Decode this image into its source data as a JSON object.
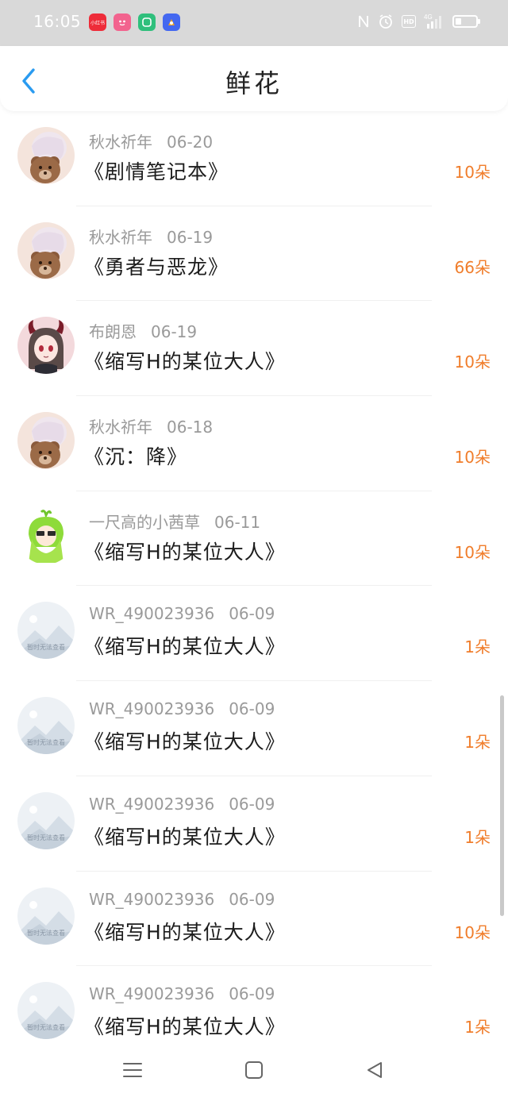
{
  "status_bar": {
    "time": "16:05",
    "app_icons": [
      {
        "name": "xiaohongshu-icon",
        "text": "小红书",
        "color": "#ee2c39"
      },
      {
        "name": "pink-app-icon",
        "text": "",
        "color": "#f2638e"
      },
      {
        "name": "green-app-icon",
        "text": "",
        "color": "#2fbf7c"
      },
      {
        "name": "blue-app-icon",
        "text": "",
        "color": "#4468f0"
      }
    ],
    "hd_label": "HD",
    "network_label": "4G",
    "battery_level": 0.3
  },
  "header": {
    "title": "鲜花",
    "back_icon": "chevron-left-icon"
  },
  "colors": {
    "accent": "#2a9bf0",
    "count": "#f07d2b",
    "meta": "#9a9a9a",
    "title": "#1c1c1c"
  },
  "items": [
    {
      "user": "秋水祈年",
      "date": "06-20",
      "book": "《剧情笔记本》",
      "count": "10朵",
      "avatar": "bear-girl"
    },
    {
      "user": "秋水祈年",
      "date": "06-19",
      "book": "《勇者与恶龙》",
      "count": "66朵",
      "avatar": "bear-girl"
    },
    {
      "user": "布朗恩",
      "date": "06-19",
      "book": "《缩写H的某位大人》",
      "count": "10朵",
      "avatar": "horned-girl"
    },
    {
      "user": "秋水祈年",
      "date": "06-18",
      "book": "《沉：降》",
      "count": "10朵",
      "avatar": "bear-girl"
    },
    {
      "user": "一尺高的小茜草",
      "date": "06-11",
      "book": "《缩写H的某位大人》",
      "count": "10朵",
      "avatar": "green-hair"
    },
    {
      "user": "WR_490023936",
      "date": "06-09",
      "book": "《缩写H的某位大人》",
      "count": "1朵",
      "avatar": "placeholder"
    },
    {
      "user": "WR_490023936",
      "date": "06-09",
      "book": "《缩写H的某位大人》",
      "count": "1朵",
      "avatar": "placeholder"
    },
    {
      "user": "WR_490023936",
      "date": "06-09",
      "book": "《缩写H的某位大人》",
      "count": "1朵",
      "avatar": "placeholder"
    },
    {
      "user": "WR_490023936",
      "date": "06-09",
      "book": "《缩写H的某位大人》",
      "count": "10朵",
      "avatar": "placeholder"
    },
    {
      "user": "WR_490023936",
      "date": "06-09",
      "book": "《缩写H的某位大人》",
      "count": "1朵",
      "avatar": "placeholder"
    }
  ],
  "placeholder_avatar_text": "暂时无法查看",
  "nav_bar": {
    "menu_icon": "menu-icon",
    "home_icon": "square-home-icon",
    "back_icon": "triangle-back-icon"
  }
}
